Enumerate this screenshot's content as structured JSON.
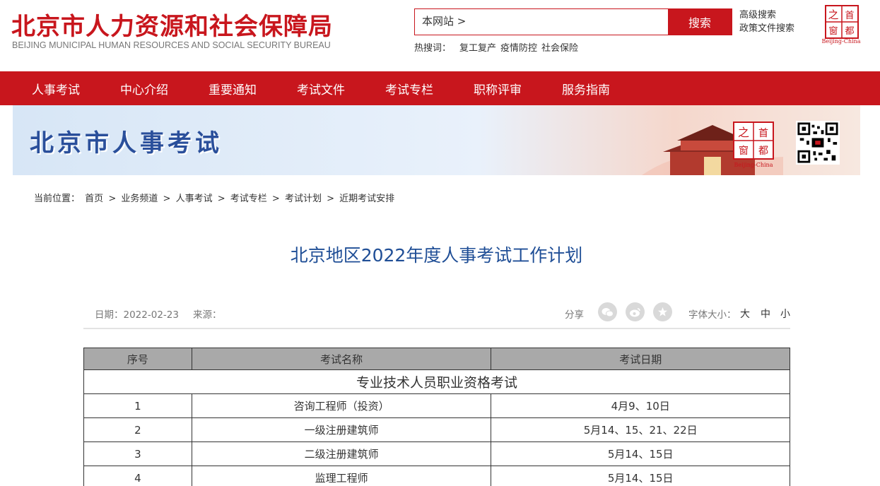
{
  "header": {
    "title": "北京市人力资源和社会保障局",
    "subtitle": "BEIJING MUNICIPAL HUMAN RESOURCES AND SOCIAL SECURITY BUREAU",
    "search_scope": "本网站 >",
    "search_button": "搜索",
    "hot_label": "热搜词：",
    "hot_terms": [
      "复工复产",
      "疫情防控",
      "社会保险"
    ],
    "advanced_search": "高级搜索",
    "policy_search": "政策文件搜索",
    "logo_chars": [
      "之",
      "首",
      "窗",
      "都"
    ],
    "logo_caption": "Beijing-China",
    "brand_color": "#c8161d"
  },
  "nav": [
    "人事考试",
    "中心介绍",
    "重要通知",
    "考试文件",
    "考试专栏",
    "职称评审",
    "服务指南"
  ],
  "banner": {
    "title": "北京市人事考试",
    "logo_caption": "Beijing-China"
  },
  "breadcrumb": {
    "label": "当前位置：",
    "items": [
      "首页",
      "业务频道",
      "人事考试",
      "考试专栏",
      "考试计划",
      "近期考试安排"
    ],
    "separator": ">"
  },
  "article": {
    "title": "北京地区2022年度人事考试工作计划",
    "date": "日期：2022-02-23",
    "source": "来源：",
    "share_label": "分享",
    "share_icons": [
      "wechat-icon",
      "weibo-icon",
      "star-icon"
    ],
    "font_label": "字体大小：",
    "font_sizes": [
      "大",
      "中",
      "小"
    ]
  },
  "table": {
    "headers": [
      "序号",
      "考试名称",
      "考试日期"
    ],
    "category": "专业技术人员职业资格考试",
    "rows": [
      [
        "1",
        "咨询工程师（投资）",
        "4月9、10日"
      ],
      [
        "2",
        "一级注册建筑师",
        "5月14、15、21、22日"
      ],
      [
        "3",
        "二级注册建筑师",
        "5月14、15日"
      ],
      [
        "4",
        "监理工程师",
        "5月14、15日"
      ]
    ]
  }
}
